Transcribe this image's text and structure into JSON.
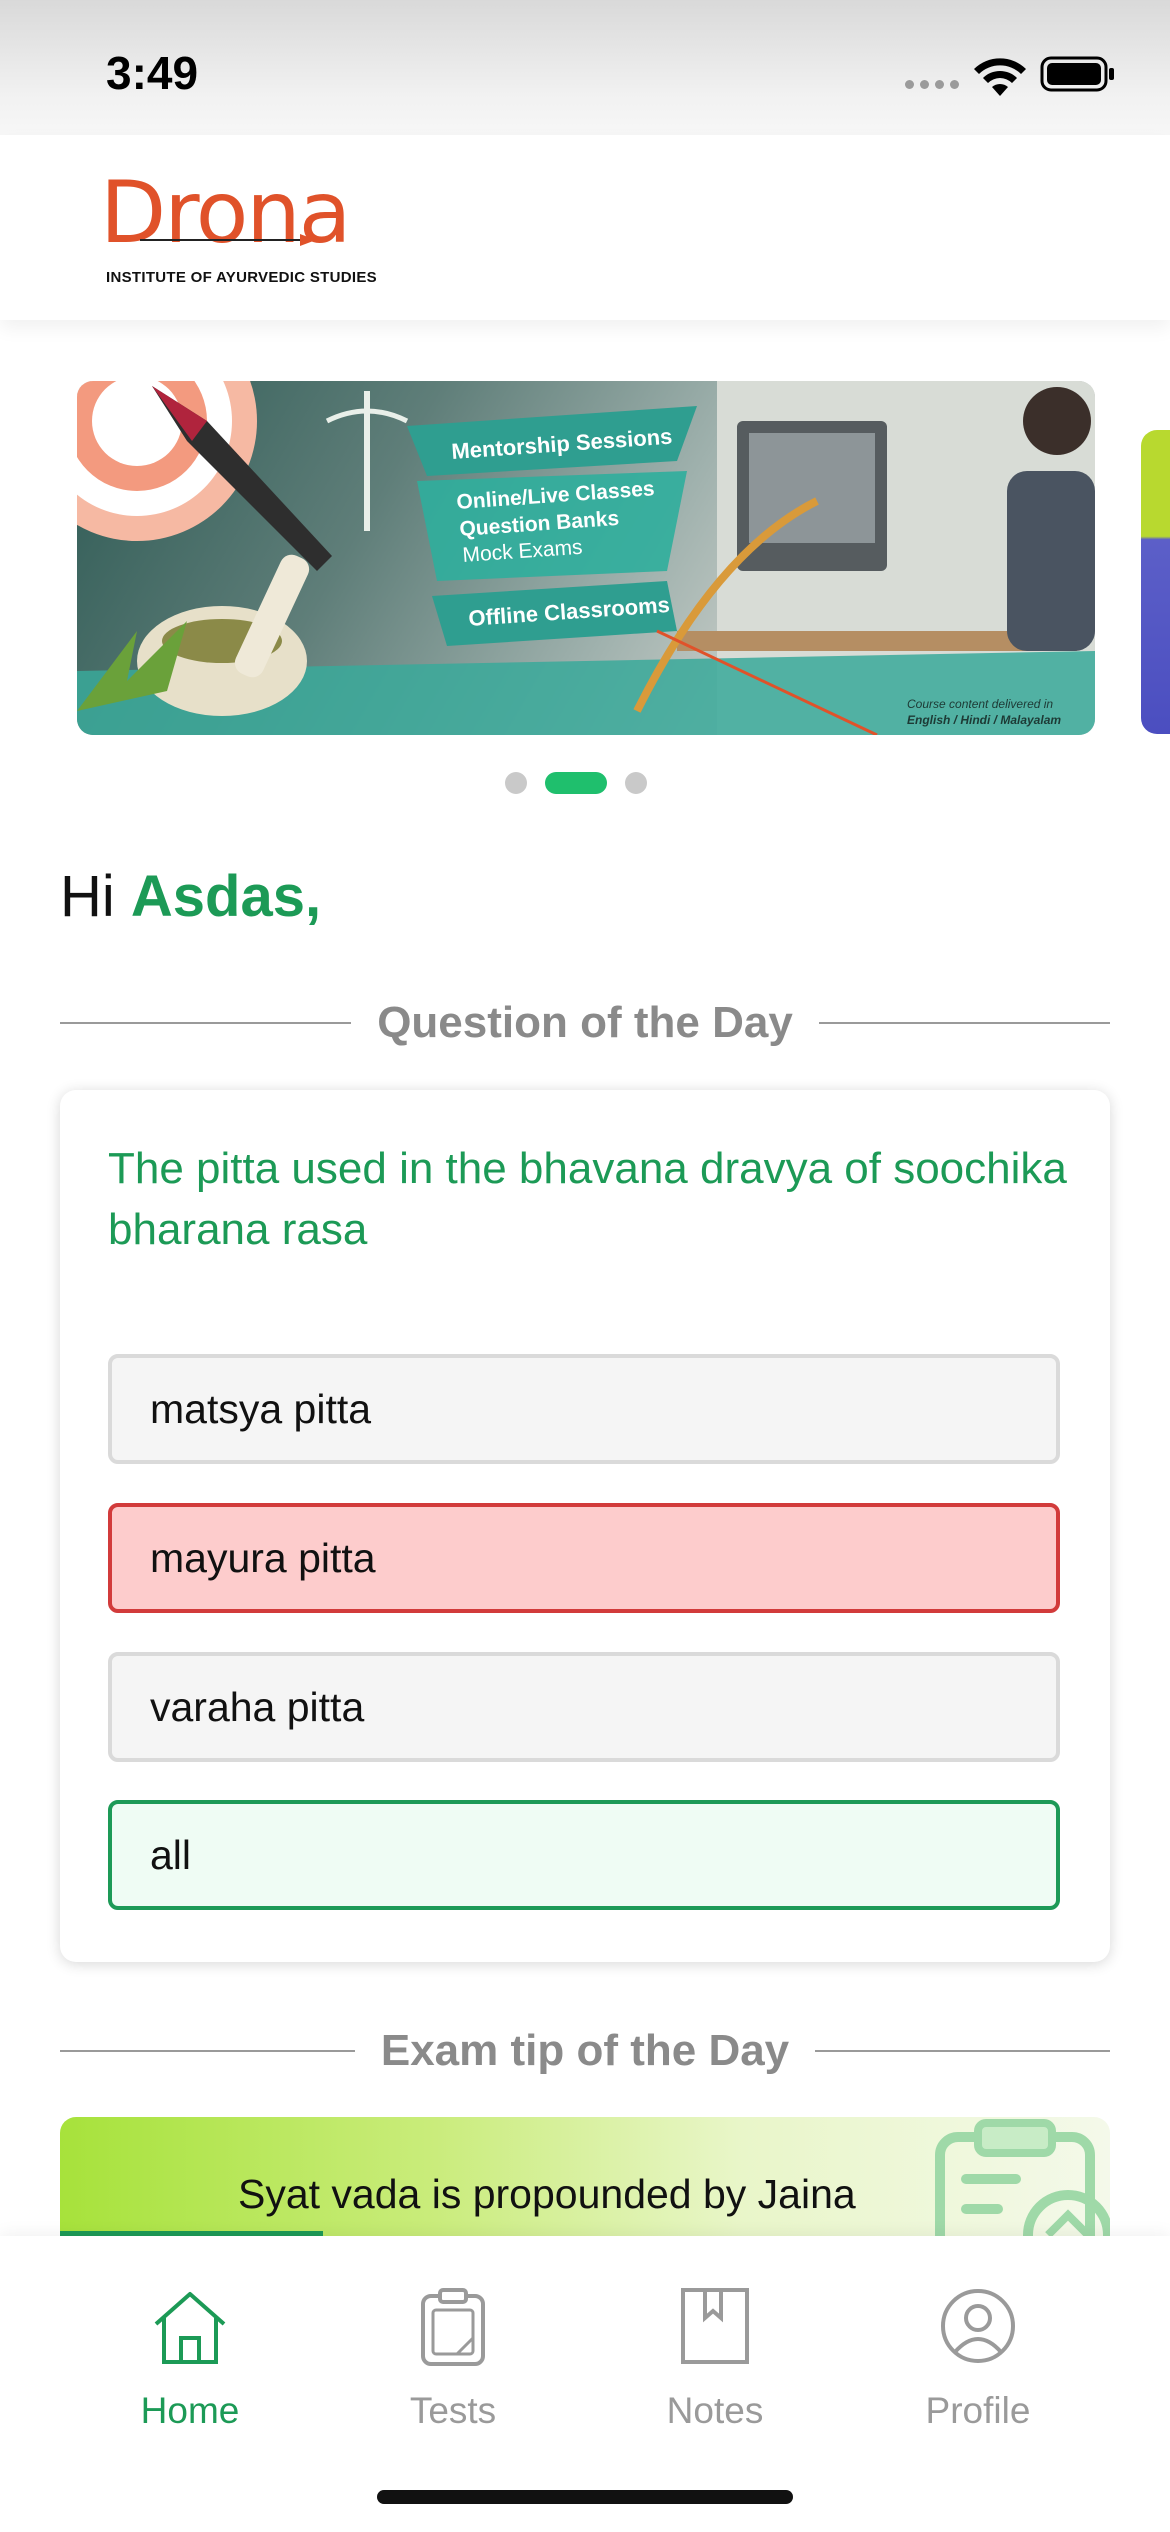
{
  "status_bar": {
    "time": "3:49"
  },
  "header": {
    "logo_text": "Drona",
    "logo_subtitle": "INSTITUTE OF AYURVEDIC STUDIES"
  },
  "banner": {
    "items": [
      "Mentorship Sessions",
      "Online/Live Classes",
      "Question Banks",
      "Mock Exams",
      "Offline Classrooms"
    ],
    "footer_line1": "Course content delivered in",
    "footer_line2": "English / Hindi / Malayalam",
    "active_slide": 2,
    "slide_count": 3
  },
  "greeting": {
    "prefix": "Hi",
    "name": "Asdas,"
  },
  "question_of_day": {
    "section_title": "Question of the Day",
    "question": "The pitta used in the bhavana dravya of soochika bharana rasa",
    "options": [
      {
        "label": "matsya pitta",
        "state": "neutral"
      },
      {
        "label": "mayura pitta",
        "state": "wrong"
      },
      {
        "label": "varaha pitta",
        "state": "neutral"
      },
      {
        "label": "all",
        "state": "correct"
      }
    ]
  },
  "exam_tip": {
    "section_title": "Exam tip of the Day",
    "text": "Syat vada is propounded by Jaina",
    "progress": 0.25
  },
  "tabbar": {
    "tabs": [
      {
        "label": "Home",
        "icon": "home-icon",
        "active": true
      },
      {
        "label": "Tests",
        "icon": "clipboard-icon",
        "active": false
      },
      {
        "label": "Notes",
        "icon": "bookmark-book-icon",
        "active": false
      },
      {
        "label": "Profile",
        "icon": "user-circle-icon",
        "active": false
      }
    ]
  },
  "colors": {
    "brand_green": "#1c9a56",
    "logo_orange": "#e0522a",
    "wrong_red": "#d23b3b",
    "active_dot": "#1fbf6d"
  }
}
